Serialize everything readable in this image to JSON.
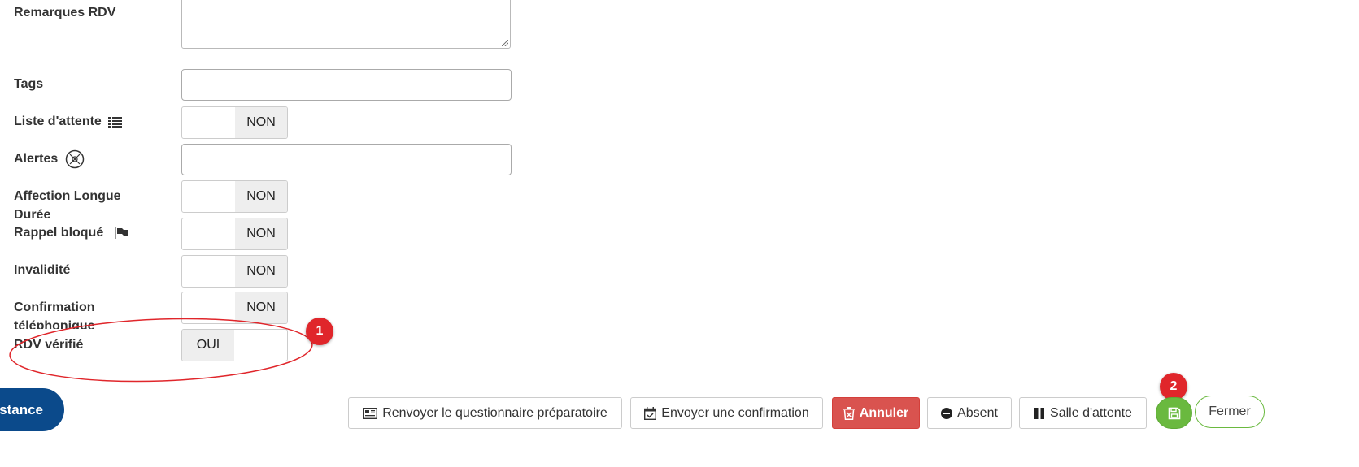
{
  "form": {
    "remarques_label": "Remarques RDV",
    "tags_label": "Tags",
    "liste_attente_label": "Liste d'attente",
    "alertes_label": "Alertes",
    "ald_label": "Affection Longue Durée",
    "rappel_label": "Rappel bloqué",
    "invalidite_label": "Invalidité",
    "confirmation_label": "Confirmation téléphonique",
    "rdv_verifie_label": "RDV vérifié",
    "toggle_off": "NON",
    "toggle_on": "OUI",
    "tags_value": "",
    "alertes_value": "",
    "remarques_value": ""
  },
  "annotations": {
    "badge1": "1",
    "badge2": "2",
    "ellipse_color": "#e0262b"
  },
  "footer": {
    "assistance_label": "stance",
    "questionnaire_label": "Renvoyer le questionnaire préparatoire",
    "confirmation_label": "Envoyer une confirmation",
    "annuler_label": "Annuler",
    "absent_label": "Absent",
    "salle_label": "Salle d'attente",
    "fermer_label": "Fermer"
  },
  "colors": {
    "annuler_bg": "#d9534f",
    "save_bg": "#6ab93f",
    "assistance_bg": "#0b4a8b"
  },
  "icons": [
    "list-icon",
    "alert-circle-icon",
    "flag-icon",
    "newspaper-icon",
    "calendar-check-icon",
    "trash-icon",
    "minus-circle-icon",
    "pause-icon",
    "save-icon"
  ]
}
